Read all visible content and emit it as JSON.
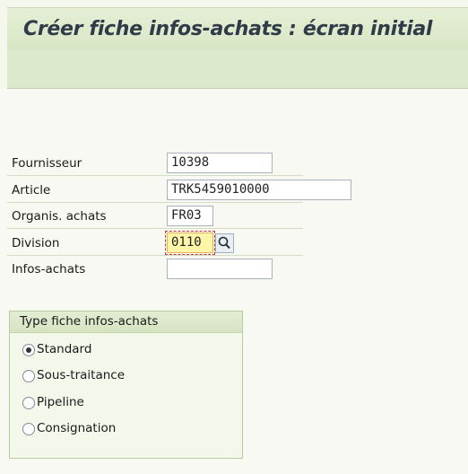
{
  "header": {
    "title": "Créer fiche infos-achats : écran initial"
  },
  "form": {
    "fields": [
      {
        "label": "Fournisseur",
        "value": "10398"
      },
      {
        "label": "Article",
        "value": "TRK5459010000"
      },
      {
        "label": "Organis. achats",
        "value": "FR03"
      },
      {
        "label": "Division",
        "value": "0110"
      },
      {
        "label": "Infos-achats",
        "value": ""
      }
    ]
  },
  "type_group": {
    "title": "Type fiche infos-achats",
    "options": [
      {
        "label": "Standard",
        "selected": true
      },
      {
        "label": "Sous-traitance",
        "selected": false
      },
      {
        "label": "Pipeline",
        "selected": false
      },
      {
        "label": "Consignation",
        "selected": false
      }
    ]
  }
}
